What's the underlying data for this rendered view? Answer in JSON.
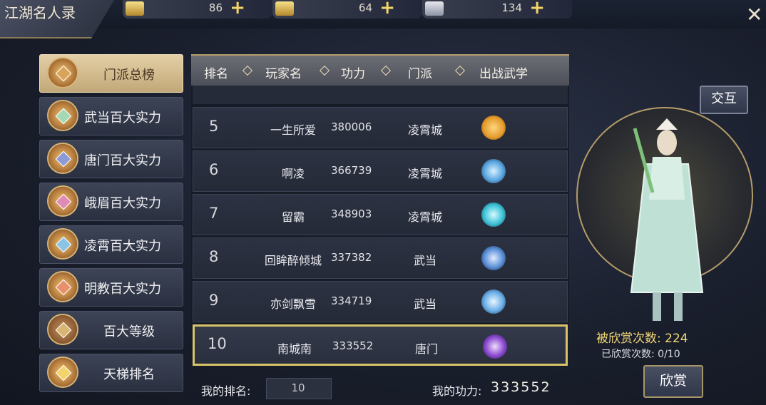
{
  "header": {
    "title": "江湖名人录",
    "currencies": [
      {
        "icon": "gold-ingot-icon",
        "value": "86"
      },
      {
        "icon": "locked-ingot-icon",
        "value": "64"
      },
      {
        "icon": "locked-silver-icon",
        "value": "134"
      }
    ]
  },
  "sidebar": {
    "items": [
      {
        "label": "门派总榜",
        "icon": "sect-emblem-icon",
        "gem": "#d8a45a",
        "active": true
      },
      {
        "label": "武当百大实力",
        "icon": "wudang-emblem-icon",
        "gem": "#a5d9b4"
      },
      {
        "label": "唐门百大实力",
        "icon": "tangmen-emblem-icon",
        "gem": "#8c9ad8"
      },
      {
        "label": "峨眉百大实力",
        "icon": "emei-emblem-icon",
        "gem": "#e08ab6"
      },
      {
        "label": "凌霄百大实力",
        "icon": "lingxiao-emblem-icon",
        "gem": "#8cc4e8"
      },
      {
        "label": "明教百大实力",
        "icon": "mingjiao-emblem-icon",
        "gem": "#e8906e"
      },
      {
        "label": "百大等级",
        "icon": "warrior-icon"
      },
      {
        "label": "天梯排名",
        "icon": "ladder-emblem-icon"
      }
    ]
  },
  "table": {
    "headers": [
      "排名",
      "玩家名",
      "功力",
      "门派",
      "出战武学"
    ],
    "rows": [
      {
        "rank": "5",
        "name": "一生所爱",
        "power": "380006",
        "sect": "凌霄城",
        "skill_color": "#e39a2a"
      },
      {
        "rank": "6",
        "name": "啊凌",
        "power": "366739",
        "sect": "凌霄城",
        "skill_color": "#5aa6e0"
      },
      {
        "rank": "7",
        "name": "留霸",
        "power": "348903",
        "sect": "凌霄城",
        "skill_color": "#3fc3d8"
      },
      {
        "rank": "8",
        "name": "回眸醉倾城",
        "power": "337382",
        "sect": "武当",
        "skill_color": "#5b8fd6"
      },
      {
        "rank": "9",
        "name": "亦剑飘雪",
        "power": "334719",
        "sect": "武当",
        "skill_color": "#6aaee8"
      },
      {
        "rank": "10",
        "name": "南城南",
        "power": "333552",
        "sect": "唐门",
        "skill_color": "#8a4ad0",
        "selected": true
      }
    ]
  },
  "footer": {
    "my_rank_label": "我的排名:",
    "my_rank_value": "10",
    "my_power_label": "我的功力:",
    "my_power_value": "333552"
  },
  "character": {
    "interact_label": "交互",
    "praised_text": "被欣赏次数: 224",
    "already_text": "已欣赏次数: 0/10",
    "praise_label": "欣赏"
  }
}
